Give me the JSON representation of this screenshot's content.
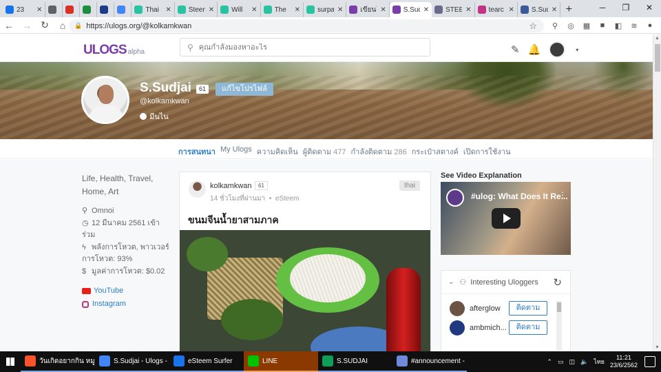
{
  "browser": {
    "tabs": [
      {
        "label": "23",
        "color": "#1a73e8",
        "active": false
      },
      {
        "label": "",
        "color": "#5f6368",
        "active": false
      },
      {
        "label": "",
        "color": "#d93025",
        "active": false
      },
      {
        "label": "",
        "color": "#1e8e3e",
        "active": false
      },
      {
        "label": "",
        "color": "#1a3e8a",
        "active": false
      },
      {
        "label": "",
        "color": "#4285f4",
        "active": false
      },
      {
        "label": "Thai",
        "color": "#2ac3a2",
        "active": false
      },
      {
        "label": "Steem",
        "color": "#2ac3a2",
        "active": false
      },
      {
        "label": "Will",
        "color": "#2ac3a2",
        "active": false
      },
      {
        "label": "The",
        "color": "#2ac3a2",
        "active": false
      },
      {
        "label": "surpa",
        "color": "#2ac3a2",
        "active": false
      },
      {
        "label": "เขียนโ",
        "color": "#7a3ea8",
        "active": false
      },
      {
        "label": "S.Sud",
        "color": "#7a3ea8",
        "active": true
      },
      {
        "label": "STEE",
        "color": "#6b6b8a",
        "active": false
      },
      {
        "label": "tearc",
        "color": "#c13584",
        "active": false
      },
      {
        "label": "S.Sud",
        "color": "#3b5998",
        "active": false
      }
    ],
    "url": "https://ulogs.org/@kolkamkwan"
  },
  "site": {
    "logo_text": "ULOGS",
    "logo_sub": "alpha",
    "search_placeholder": "คุณกำลังมองหาอะไร"
  },
  "profile": {
    "name": "S.Sudjai",
    "reputation": "61",
    "edit_label": "แก้ไขโปรไฟล์",
    "handle": "@kolkamkwan",
    "badge": "มีนไน"
  },
  "tabs": {
    "conversations": "การสนทนา",
    "my_ulogs": "My Ulogs",
    "comments": "ความคิดเห็น",
    "followers": "ผู้ติดตาม",
    "followers_count": "477",
    "following": "กำลังติดตาม",
    "following_count": "286",
    "wallet": "กระเป๋าสตางค์",
    "activity": "เปิดการใช้งาน"
  },
  "sidebar": {
    "bio": "Life, Health, Travel, Home, Art",
    "location": "Omnoi",
    "joined": "12 มีนาคม 2561 เข้าร่วม",
    "voting_power": "พลังการโหวต, พาวเวอร์การโหวต: 93%",
    "vote_value": "มูลค่าการโหวต: $0.02",
    "youtube": "YouTube",
    "instagram": "Instagram"
  },
  "post": {
    "author": "kolkamkwan",
    "author_rep": "61",
    "time": "14 ชั่วโมงที่ผ่านมา",
    "app": "eSteem",
    "tag": "thai",
    "title": "ขนมจีนน้ำยาสามภาค"
  },
  "right": {
    "video_heading": "See Video Explanation",
    "video_title": "#ulog: What Does It Re...",
    "uloggers_title": "Interesting Uloggers",
    "uloggers": [
      {
        "name": "afterglow",
        "button": "ติดตาม"
      },
      {
        "name": "ambmich...",
        "button": "ติดตาม"
      }
    ]
  },
  "taskbar": {
    "items": [
      {
        "label": "วันเกิดอยากกิน หมูกระท...",
        "color": "#fb542b"
      },
      {
        "label": "S.Sudjai - Ulogs - G...",
        "color": "#4285f4"
      },
      {
        "label": "eSteem Surfer",
        "color": "#1a73e8"
      },
      {
        "label": "LINE",
        "color": "#00c300"
      },
      {
        "label": "S.SUDJAI",
        "color": "#0f9d58"
      },
      {
        "label": "#announcement - ...",
        "color": "#7289da"
      }
    ],
    "lang": "ไทย",
    "time": "11:21",
    "date": "23/6/2562"
  }
}
